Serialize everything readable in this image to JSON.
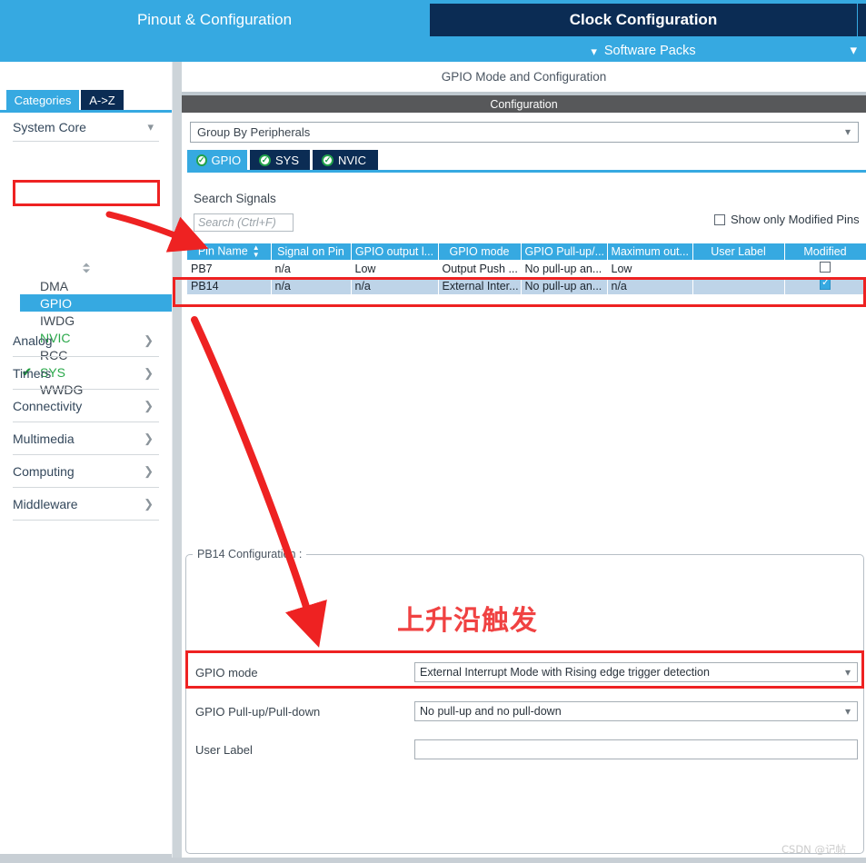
{
  "banner": {
    "pinout_tab": "Pinout & Configuration",
    "clock_tab": "Clock Configuration",
    "software_packs": "Software Packs",
    "caret_icon": "chevron-down-icon"
  },
  "left_panel": {
    "search_value": "",
    "search_icon": "search-icon",
    "gear_icon": "gear-icon",
    "tabs": [
      {
        "label": "Categories",
        "active": true
      },
      {
        "label": "A->Z",
        "active": false
      }
    ],
    "system_core": {
      "label": "System Core",
      "caret": "chevron-down-icon",
      "items": [
        {
          "label": "DMA",
          "selected": false,
          "configured": false,
          "checked": false
        },
        {
          "label": "GPIO",
          "selected": true,
          "configured": false,
          "checked": false
        },
        {
          "label": "IWDG",
          "selected": false,
          "configured": false,
          "checked": false
        },
        {
          "label": "NVIC",
          "selected": false,
          "configured": true,
          "checked": false
        },
        {
          "label": "RCC",
          "selected": false,
          "configured": false,
          "checked": false
        },
        {
          "label": "SYS",
          "selected": false,
          "configured": true,
          "checked": true
        },
        {
          "label": "WWDG",
          "selected": false,
          "configured": false,
          "checked": false
        }
      ]
    },
    "categories": [
      {
        "label": "Analog",
        "caret": "chevron-right-icon"
      },
      {
        "label": "Timers",
        "caret": "chevron-right-icon"
      },
      {
        "label": "Connectivity",
        "caret": "chevron-right-icon"
      },
      {
        "label": "Multimedia",
        "caret": "chevron-right-icon"
      },
      {
        "label": "Computing",
        "caret": "chevron-right-icon"
      },
      {
        "label": "Middleware",
        "caret": "chevron-right-icon"
      }
    ]
  },
  "right_panel": {
    "mode_title": "GPIO Mode and Configuration",
    "configuration_bar": "Configuration",
    "group_by": "Group By Peripherals",
    "group_by_caret": "chevron-down-icon",
    "peripheral_tabs": [
      {
        "label": "GPIO",
        "active": true,
        "status_icon": "check-circle-icon"
      },
      {
        "label": "SYS",
        "active": false,
        "status_icon": "check-circle-icon"
      },
      {
        "label": "NVIC",
        "active": false,
        "status_icon": "check-circle-icon"
      }
    ],
    "search_signals_label": "Search Signals",
    "search_signals_placeholder": "Search (Ctrl+F)",
    "search_signals_value": "",
    "show_only_modified": {
      "label": "Show only Modified Pins",
      "checked": false
    },
    "table": {
      "columns": [
        "Pin Name",
        "Signal on Pin",
        "GPIO output l...",
        "GPIO mode",
        "GPIO Pull-up/...",
        "Maximum out...",
        "User Label",
        "Modified"
      ],
      "sort_column": "Pin Name",
      "sort_icon": "sort-updown-icon",
      "rows": [
        {
          "pin_name": "PB7",
          "signal_on_pin": "n/a",
          "gpio_output_level": "Low",
          "gpio_mode": "Output Push ...",
          "gpio_pull": "No pull-up an...",
          "maximum_output": "Low",
          "user_label": "",
          "modified": false,
          "selected": false
        },
        {
          "pin_name": "PB14",
          "signal_on_pin": "n/a",
          "gpio_output_level": "n/a",
          "gpio_mode": "External Inter...",
          "gpio_pull": "No pull-up an...",
          "maximum_output": "n/a",
          "user_label": "",
          "modified": true,
          "selected": true
        }
      ]
    },
    "pin_config": {
      "legend": "PB14 Configuration :",
      "fields": [
        {
          "label": "GPIO mode",
          "value": "External Interrupt Mode with Rising edge trigger detection",
          "type": "dropdown",
          "caret": "chevron-down-icon"
        },
        {
          "label": "GPIO Pull-up/Pull-down",
          "value": "No pull-up and no pull-down",
          "type": "dropdown",
          "caret": "chevron-down-icon"
        },
        {
          "label": "User Label",
          "value": "",
          "type": "text",
          "caret": ""
        }
      ]
    }
  },
  "annotations": {
    "chinese_note": "上升沿触发",
    "accent_red": "#ee2222",
    "accent_blue": "#36a9e1",
    "dark_blue": "#0b2c54"
  },
  "watermark": "CSDN @记帖"
}
